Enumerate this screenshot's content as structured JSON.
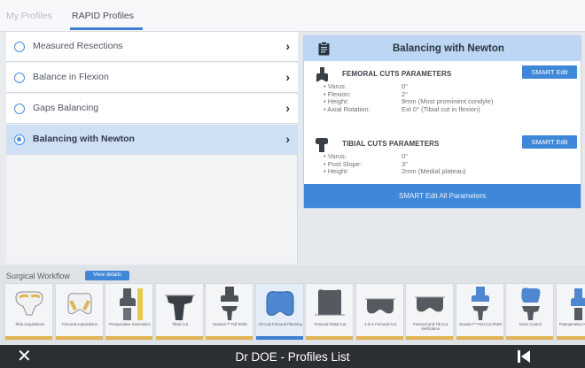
{
  "tabs": [
    {
      "label": "My Profiles",
      "active": false
    },
    {
      "label": "RAPID Profiles",
      "active": true
    }
  ],
  "profiles": [
    {
      "label": "Measured Resections",
      "selected": false
    },
    {
      "label": "Balance in Flexion",
      "selected": false
    },
    {
      "label": "Gaps Balancing",
      "selected": false
    },
    {
      "label": "Balancing with Newton",
      "selected": true
    }
  ],
  "detail": {
    "title": "Balancing with Newton",
    "femoral": {
      "title": "FEMORAL CUTS PARAMETERS",
      "button": "SMART Edit",
      "params": [
        {
          "label": "• Varus:",
          "value": "0°"
        },
        {
          "label": "• Flexion:",
          "value": "2°"
        },
        {
          "label": "• Height:",
          "value": "9mm (Most prominent condyle)"
        },
        {
          "label": "• Axial Rotation:",
          "value": "Ext 0° (Tibial cut in flexion)"
        }
      ]
    },
    "tibial": {
      "title": "TIBIAL CUTS PARAMETERS",
      "button": "SMART Edit",
      "params": [
        {
          "label": "• Varus:",
          "value": "0°"
        },
        {
          "label": "• Post Slope:",
          "value": "3°"
        },
        {
          "label": "• Height:",
          "value": "2mm (Medial plateau)"
        }
      ]
    },
    "edit_all": "SMART Edit All Parameters"
  },
  "workflow": {
    "label": "Surgical Workflow",
    "details_button": "View details",
    "steps": [
      {
        "caption": "Tibia Acquisitions",
        "icon": "tibia-plateau-icon",
        "current": false
      },
      {
        "caption": "Femoral Acquisitions",
        "icon": "femur-condyles-icon",
        "current": false
      },
      {
        "caption": "Preoperative Kinematics",
        "icon": "knee-kinematics-icon",
        "current": false
      },
      {
        "caption": "Tibial Cut",
        "icon": "tibial-cut-icon",
        "current": false
      },
      {
        "caption": "Newton™ Full ROM",
        "icon": "knee-rom-icon",
        "current": false
      },
      {
        "caption": "All Cuts Femoral Planning",
        "icon": "femoral-planning-icon",
        "current": true
      },
      {
        "caption": "Femoral Distal Cut",
        "icon": "femoral-distal-cut-icon",
        "current": false
      },
      {
        "caption": "4-in-1 Femoral Cut",
        "icon": "femoral-4in1-cut-icon",
        "current": false
      },
      {
        "caption": "Femoral and Tib Cut Verification",
        "icon": "cut-verification-icon",
        "current": false
      },
      {
        "caption": "Newton™ Post Cut ROM",
        "icon": "post-cut-rom-icon",
        "current": false
      },
      {
        "caption": "Knee Control",
        "icon": "knee-control-icon",
        "current": false
      },
      {
        "caption": "Postoperative Kinematics",
        "icon": "postop-kinematics-icon",
        "current": false
      }
    ]
  },
  "footer": {
    "title": "Dr DOE - Profiles List"
  },
  "colors": {
    "accent": "#3f87d8",
    "selected_row": "#cfe0f5",
    "header": "#bcd6f3",
    "footer": "#2b2e33",
    "step_bar": "#e2b452"
  }
}
